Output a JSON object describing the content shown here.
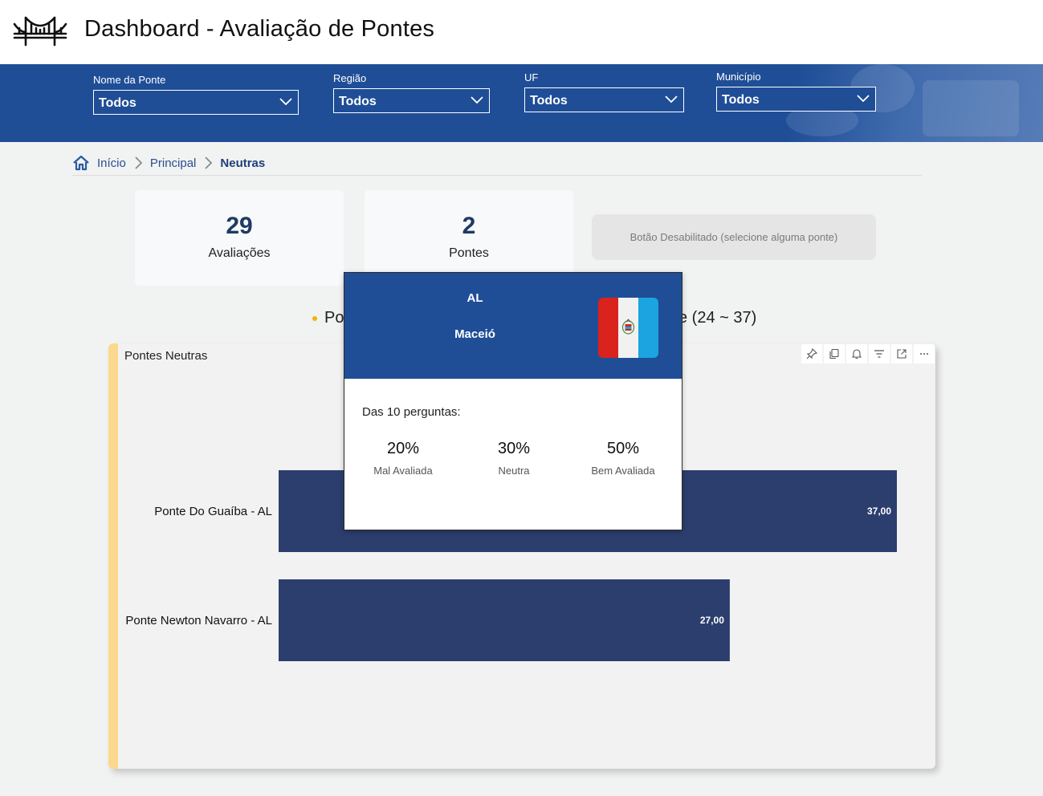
{
  "header": {
    "title": "Dashboard - Avaliação de Pontes",
    "logo_icon": "bridge-icon"
  },
  "filters": [
    {
      "label": "Nome da Ponte",
      "value": "Todos"
    },
    {
      "label": "Região",
      "value": "Todos"
    },
    {
      "label": "UF",
      "value": "Todos"
    },
    {
      "label": "Município",
      "value": "Todos"
    }
  ],
  "breadcrumb": {
    "home": "Início",
    "principal": "Principal",
    "current": "Neutras"
  },
  "kpis": [
    {
      "value": "29",
      "label": "Avaliações"
    },
    {
      "value": "2",
      "label": "Pontes"
    }
  ],
  "disabled_button": "Botão Desabilitado (selecione alguma ponte)",
  "subtitle": {
    "left": "Po",
    "right": "e (24 ~ 37)"
  },
  "chart_data": {
    "type": "bar",
    "orientation": "horizontal",
    "title": "Pontes Neutras",
    "categories": [
      "Ponte Do Guaíba - AL",
      "Ponte Newton Navarro - AL"
    ],
    "values": [
      37.0,
      27.0
    ],
    "data_labels": [
      "37,00",
      "27,00"
    ],
    "xlim": [
      0,
      37
    ],
    "color": "#2c3e6e"
  },
  "tooltip": {
    "uf": "AL",
    "city": "Maceió",
    "question": "Das 10 perguntas:",
    "stats": [
      {
        "pct": "20%",
        "label": "Mal Avaliada"
      },
      {
        "pct": "30%",
        "label": "Neutra"
      },
      {
        "pct": "50%",
        "label": "Bem Avaliada"
      }
    ]
  },
  "colors": {
    "brand_blue": "#1f4e97",
    "bar_navy": "#2c3e6e",
    "accent_yellow": "#fbd98c"
  }
}
